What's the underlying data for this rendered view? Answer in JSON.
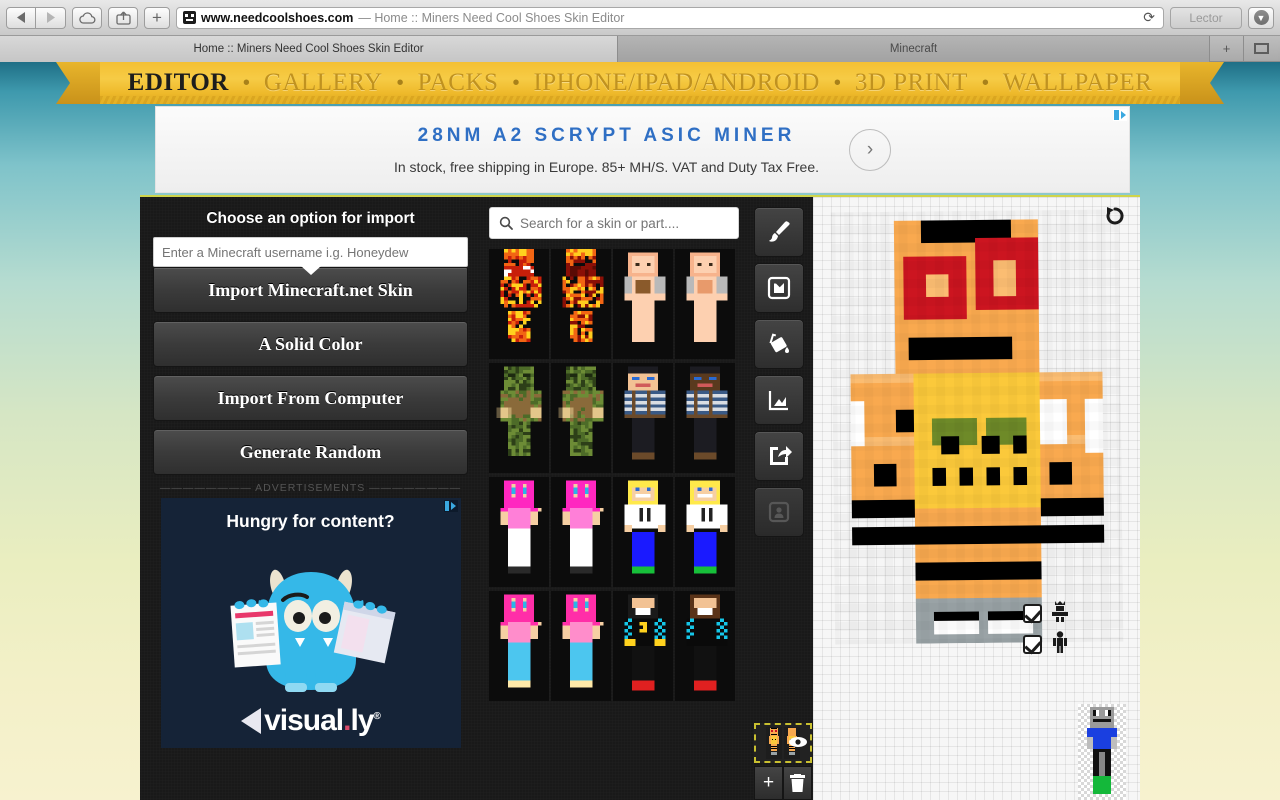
{
  "browser": {
    "back_icon": "back-arrow-icon",
    "forward_icon": "forward-arrow-icon",
    "cloud_icon": "icloud-icon",
    "share_icon": "share-icon",
    "newtab_label": "+",
    "url_domain": "www.needcoolshoes.com",
    "url_title": "— Home :: Miners Need Cool Shoes Skin Editor",
    "reload_icon": "reload-icon",
    "reader_label": "Lector",
    "download_icon": "downloads-icon",
    "tabs": [
      {
        "label": "Home :: Miners Need Cool Shoes Skin Editor",
        "active": true
      },
      {
        "label": "Minecraft",
        "active": false
      }
    ],
    "tab_new_label": "+",
    "tab_overview_icon": "tab-overview-icon"
  },
  "site_nav": {
    "items": [
      {
        "label": "EDITOR",
        "active": true
      },
      {
        "label": "GALLERY",
        "active": false
      },
      {
        "label": "PACKS",
        "active": false
      },
      {
        "label": "IPHONE/IPAD/ANDROID",
        "active": false
      },
      {
        "label": "3D PRINT",
        "active": false
      },
      {
        "label": "WALLPAPER",
        "active": false
      }
    ],
    "separator": "•",
    "ribbon_color": "#f4c033",
    "active_color": "#1d1d1d",
    "inactive_color": "#c0921f"
  },
  "top_ad": {
    "headline": "28NM A2 SCRYPT ASIC MINER",
    "subtext": "In stock, free shipping in Europe. 85+ MH/S. VAT and Duty Tax Free.",
    "arrow_icon": "chevron-right-icon",
    "adchoices_icon": "adchoices-icon",
    "headline_color": "#2f6fc4"
  },
  "import_panel": {
    "title": "Choose an option for import",
    "username_placeholder": "Enter a Minecraft username i.g. Honeydew",
    "username_value": "",
    "buttons": [
      "Import Minecraft.net Skin",
      "A Solid Color",
      "Import From Computer",
      "Generate Random"
    ]
  },
  "sidebar_ad": {
    "label": "———————— ADVERTISEMENTS ————————",
    "headline": "Hungry for content?",
    "brand": "visual",
    "brand_dot": ".",
    "brand_suffix": "ly",
    "brand_reg": "®",
    "adchoices_icon": "adchoices-icon",
    "background": "#152337"
  },
  "gallery": {
    "search_placeholder": "Search for a skin or part....",
    "search_value": "",
    "search_icon": "search-icon",
    "skins": [
      {
        "name": "fire-skin-front",
        "palette": [
          "#0a0a0a",
          "#c81f0a",
          "#f26513",
          "#ffd21e",
          "#ffffff"
        ]
      },
      {
        "name": "fire-skin-back",
        "palette": [
          "#0a0a0a",
          "#8a0f06",
          "#f26513",
          "#ffcc1e",
          "#5a0a04"
        ]
      },
      {
        "name": "peach-girl-front",
        "palette": [
          "#f7b38c",
          "#fdd0b0",
          "#b9b9b9",
          "#8a5a2b",
          "#2a2a2a"
        ]
      },
      {
        "name": "peach-girl-back",
        "palette": [
          "#f7b38c",
          "#fdd0b0",
          "#b9b9b9",
          "#e89a6b",
          "#cfcfcf"
        ]
      },
      {
        "name": "moss-golem-front",
        "palette": [
          "#4d6b28",
          "#6d8c36",
          "#8a6a3a",
          "#e3c68a",
          "#2d3f18"
        ]
      },
      {
        "name": "moss-golem-back",
        "palette": [
          "#4d6b28",
          "#6d8c36",
          "#8a6a3a",
          "#e3c68a",
          "#2d3f18"
        ]
      },
      {
        "name": "sailor-front",
        "palette": [
          "#3a5a86",
          "#d9dde3",
          "#6b4a2a",
          "#1c1c22",
          "#f2c294"
        ]
      },
      {
        "name": "sailor-back",
        "palette": [
          "#3a5a86",
          "#d9dde3",
          "#6b4a2a",
          "#1c1c22",
          "#5a3a1e"
        ]
      },
      {
        "name": "pink-girl-a-front",
        "palette": [
          "#ff27c0",
          "#ff7fd8",
          "#f6cfa3",
          "#ffffff",
          "#2a2a2a"
        ]
      },
      {
        "name": "pink-girl-a-back",
        "palette": [
          "#ff27c0",
          "#ff7fd8",
          "#f6cfa3",
          "#ffffff",
          "#2a2a2a"
        ]
      },
      {
        "name": "hoodie-boy-front",
        "palette": [
          "#ffe94a",
          "#ffffff",
          "#1a1aff",
          "#17c03a",
          "#f6cfa3"
        ]
      },
      {
        "name": "hoodie-boy-back",
        "palette": [
          "#ffe94a",
          "#ffffff",
          "#1a1aff",
          "#17c03a",
          "#f6cfa3"
        ]
      },
      {
        "name": "pink-girl-b-front",
        "palette": [
          "#ff2ea8",
          "#ff8dcb",
          "#f6cfa3",
          "#4cc6ef",
          "#ffe9a8"
        ]
      },
      {
        "name": "pink-girl-b-back",
        "palette": [
          "#ff2ea8",
          "#ff8dcb",
          "#f6cfa3",
          "#4cc6ef",
          "#ffe9a8"
        ]
      },
      {
        "name": "checker-rapper-front",
        "palette": [
          "#15c6e8",
          "#0a0a0a",
          "#ffd21e",
          "#ffffff",
          "#e02020"
        ]
      },
      {
        "name": "checker-rapper-back",
        "palette": [
          "#15c6e8",
          "#5a3318",
          "#0a0a0a",
          "#ffffff",
          "#e02020"
        ]
      }
    ]
  },
  "tools": [
    {
      "name": "brush-tool",
      "icon": "paintbrush-icon",
      "active": true,
      "disabled": false
    },
    {
      "name": "image-tool",
      "icon": "import-image-icon",
      "active": false,
      "disabled": false
    },
    {
      "name": "fill-tool",
      "icon": "paint-bucket-icon",
      "active": false,
      "disabled": false
    },
    {
      "name": "gradient-tool",
      "icon": "gradient-chart-icon",
      "active": false,
      "disabled": false
    },
    {
      "name": "export-tool",
      "icon": "share-export-icon",
      "active": false,
      "disabled": false
    },
    {
      "name": "profile-tool",
      "icon": "person-card-icon",
      "active": false,
      "disabled": true
    }
  ],
  "layer_bar": {
    "thumb_name": "current-skin-thumbnail",
    "eye_icon": "eye-visible-icon",
    "add_label": "+",
    "delete_icon": "trash-icon",
    "selected_border_color": "#c9c030"
  },
  "canvas": {
    "undo_icon": "undo-rotate-icon",
    "grid_visible": true,
    "background": "#f6f6f6",
    "view_toggles": [
      {
        "name": "toggle-overlay-layer",
        "icon": "armor-overlay-icon",
        "checked": true
      },
      {
        "name": "toggle-base-layer",
        "icon": "body-figure-icon",
        "checked": true
      }
    ],
    "main_skin": {
      "name": "orange-tiger-skin",
      "colors": {
        "skin_orange": "#f9a košič",
        "head_orange": "#f9a košič"
      }
    },
    "preview_skin": {
      "name": "steve-preview",
      "palette": [
        "#9a9a9a",
        "#1a3fe0",
        "#111111",
        "#14b83a"
      ]
    }
  }
}
